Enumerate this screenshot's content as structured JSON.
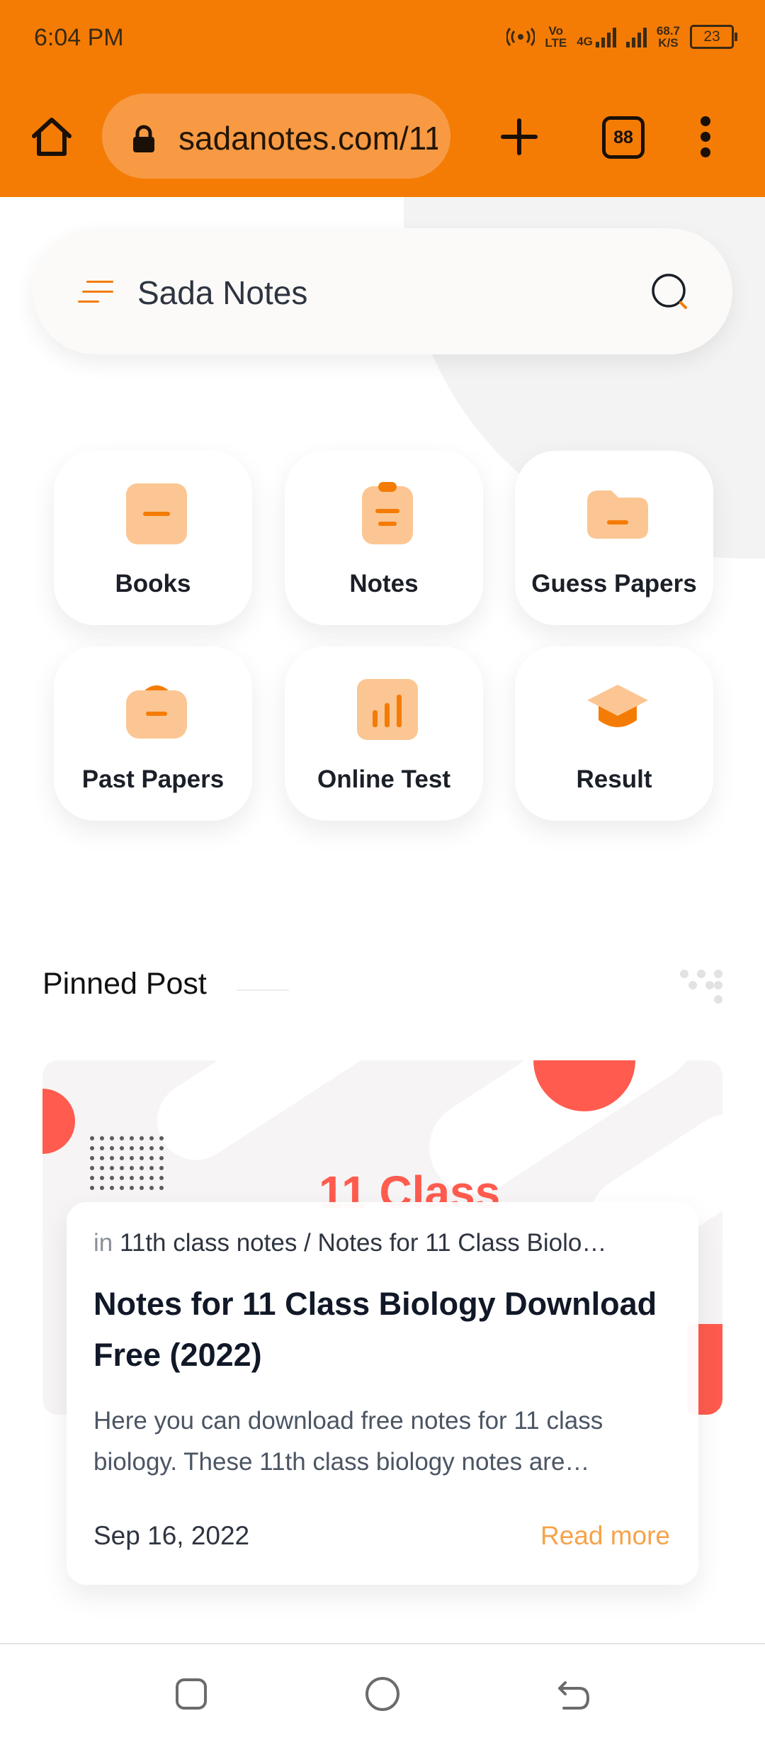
{
  "status_bar": {
    "time": "6:04 PM",
    "volte_top": "Vo",
    "volte_bottom": "LTE",
    "network_type": "4G",
    "speed_value": "68.7",
    "speed_unit": "K/S",
    "battery": "23"
  },
  "browser": {
    "url": "sadanotes.com/11",
    "tab_count": "88",
    "icons": [
      "home-icon",
      "lock-icon",
      "plus-icon",
      "tabs-icon",
      "more-vert-icon"
    ],
    "accent_color": "#f47c05"
  },
  "header": {
    "site_title": "Sada Notes"
  },
  "categories": [
    {
      "label": "Books",
      "icon": "book-icon"
    },
    {
      "label": "Notes",
      "icon": "clipboard-icon"
    },
    {
      "label": "Guess Papers",
      "icon": "folder-icon"
    },
    {
      "label": "Past Papers",
      "icon": "archive-icon"
    },
    {
      "label": "Online Test",
      "icon": "chart-bars-icon"
    },
    {
      "label": "Result",
      "icon": "graduation-cap-icon"
    }
  ],
  "pinned": {
    "heading": "Pinned Post",
    "post": {
      "image_text": "11 Class",
      "category_prefix": "in",
      "categories": "11th class notes / Notes for 11 Class Biolo…",
      "title": "Notes for 11 Class Biology Download Free (2022)",
      "excerpt": "Here you can download free notes for 11 class biology. These 11th class biology notes are…",
      "date": "Sep 16, 2022",
      "read_more": "Read more"
    }
  },
  "nav": {
    "icons": [
      "recent-apps-icon",
      "home-circle-icon",
      "back-icon"
    ]
  }
}
